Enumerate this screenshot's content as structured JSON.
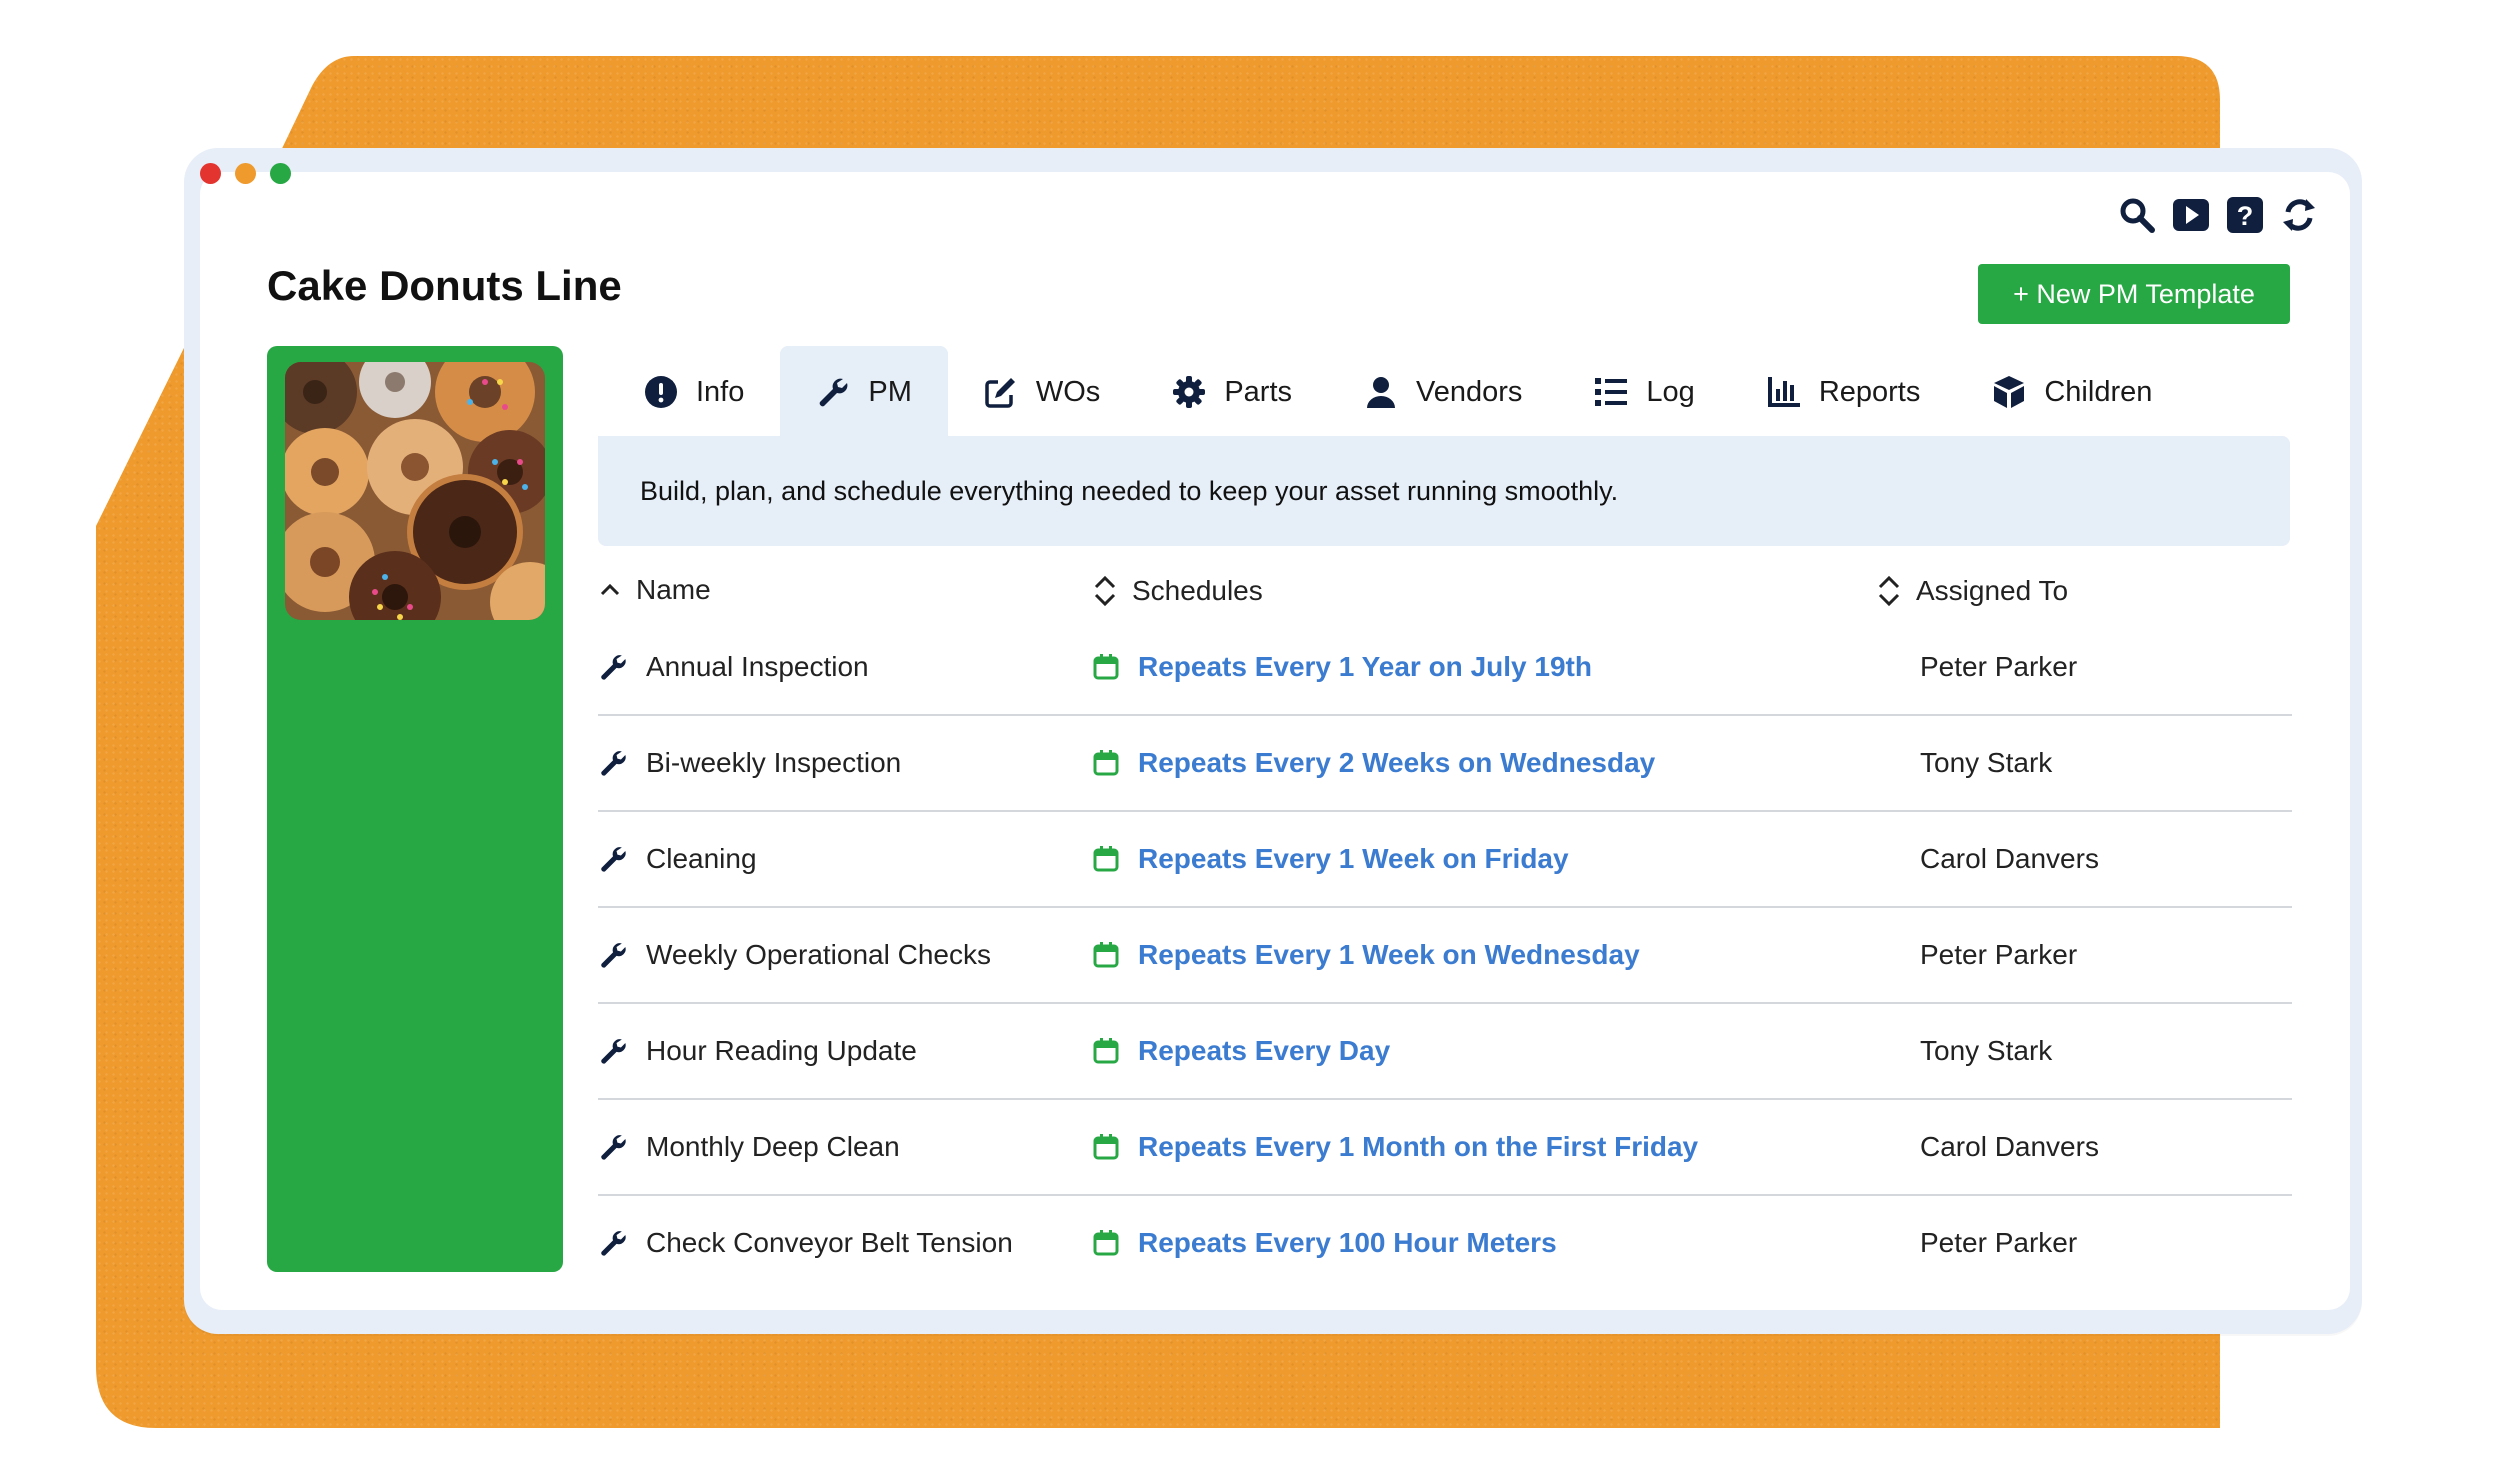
{
  "page": {
    "title": "Cake Donuts Line",
    "new_button_label": "+ New PM Template",
    "banner_text": "Build, plan, and schedule everything needed to keep your asset running smoothly."
  },
  "toolbar_icons": [
    "search-icon",
    "play-icon",
    "help-icon",
    "refresh-icon"
  ],
  "tabs": [
    {
      "label": "Info",
      "icon": "info-icon",
      "active": false
    },
    {
      "label": "PM",
      "icon": "wrench-icon",
      "active": true
    },
    {
      "label": "WOs",
      "icon": "edit-icon",
      "active": false
    },
    {
      "label": "Parts",
      "icon": "gear-icon",
      "active": false
    },
    {
      "label": "Vendors",
      "icon": "user-icon",
      "active": false
    },
    {
      "label": "Log",
      "icon": "list-icon",
      "active": false
    },
    {
      "label": "Reports",
      "icon": "chart-icon",
      "active": false
    },
    {
      "label": "Children",
      "icon": "cube-icon",
      "active": false
    }
  ],
  "table": {
    "columns": [
      "Name",
      "Schedules",
      "Assigned To"
    ],
    "rows": [
      {
        "name": "Annual Inspection",
        "schedule": "Repeats Every 1 Year on July 19th",
        "assigned": "Peter Parker"
      },
      {
        "name": "Bi-weekly Inspection",
        "schedule": "Repeats Every 2 Weeks on Wednesday",
        "assigned": "Tony Stark"
      },
      {
        "name": "Cleaning",
        "schedule": "Repeats Every 1 Week on Friday",
        "assigned": "Carol Danvers"
      },
      {
        "name": "Weekly Operational Checks",
        "schedule": "Repeats Every 1 Week on Wednesday",
        "assigned": "Peter Parker"
      },
      {
        "name": "Hour Reading Update",
        "schedule": "Repeats Every Day",
        "assigned": "Tony Stark"
      },
      {
        "name": "Monthly Deep Clean",
        "schedule": "Repeats Every 1 Month on the First Friday",
        "assigned": "Carol Danvers"
      },
      {
        "name": "Check Conveyor Belt Tension",
        "schedule": "Repeats Every 100 Hour Meters",
        "assigned": "Peter Parker"
      }
    ]
  },
  "colors": {
    "accent_green": "#28a745",
    "schedule_blue": "#3b7bd0",
    "backdrop_orange": "#ef9a2c",
    "frame_blue": "#e7eef8"
  }
}
